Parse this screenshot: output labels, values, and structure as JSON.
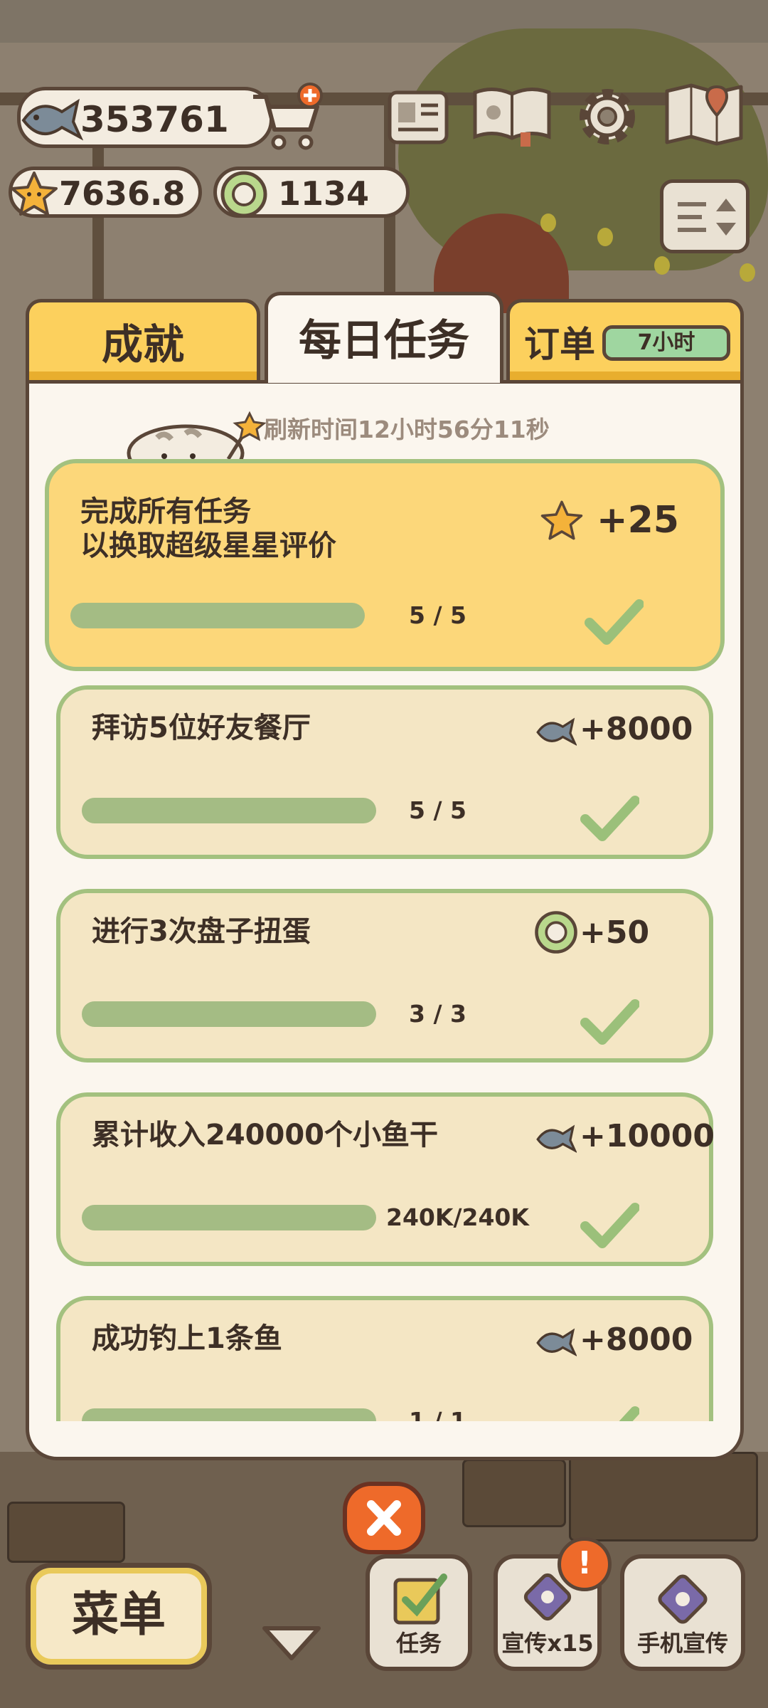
{
  "hud": {
    "fish_value": "353761",
    "star_value": "7636.8",
    "coin_value": "1134"
  },
  "tabs": {
    "achievements": "成就",
    "daily": "每日任务",
    "orders": "订单",
    "orders_timer": "7小时"
  },
  "refresh_text": "刷新时间12小时56分11秒",
  "tasks": [
    {
      "title_line1": "完成所有任务",
      "title_line2": "以换取超级星星评价",
      "reward": "+25",
      "reward_icon": "star-icon",
      "progress": "5  /  5",
      "progress_fraction": 1.0,
      "completed": true
    },
    {
      "title": "拜访5位好友餐厅",
      "reward": "+8000",
      "reward_icon": "fish-icon",
      "progress": "5  /  5",
      "progress_fraction": 1.0,
      "completed": true
    },
    {
      "title": "进行3次盘子扭蛋",
      "reward": "+50",
      "reward_icon": "coin-icon",
      "progress": "3  /  3",
      "progress_fraction": 1.0,
      "completed": true
    },
    {
      "title": "累计收入240000个小鱼干",
      "reward": "+10000",
      "reward_icon": "fish-icon",
      "progress": "240K/240K",
      "progress_fraction": 1.0,
      "completed": true
    },
    {
      "title": "成功钓上1条鱼",
      "reward": "+8000",
      "reward_icon": "fish-icon",
      "progress": "1  /  1",
      "progress_fraction": 1.0,
      "completed": true
    }
  ],
  "bottom": {
    "menu": "菜单",
    "tasks": "任务",
    "promo": "宣传x15",
    "phone_promo": "手机宣传",
    "alert": "!"
  }
}
